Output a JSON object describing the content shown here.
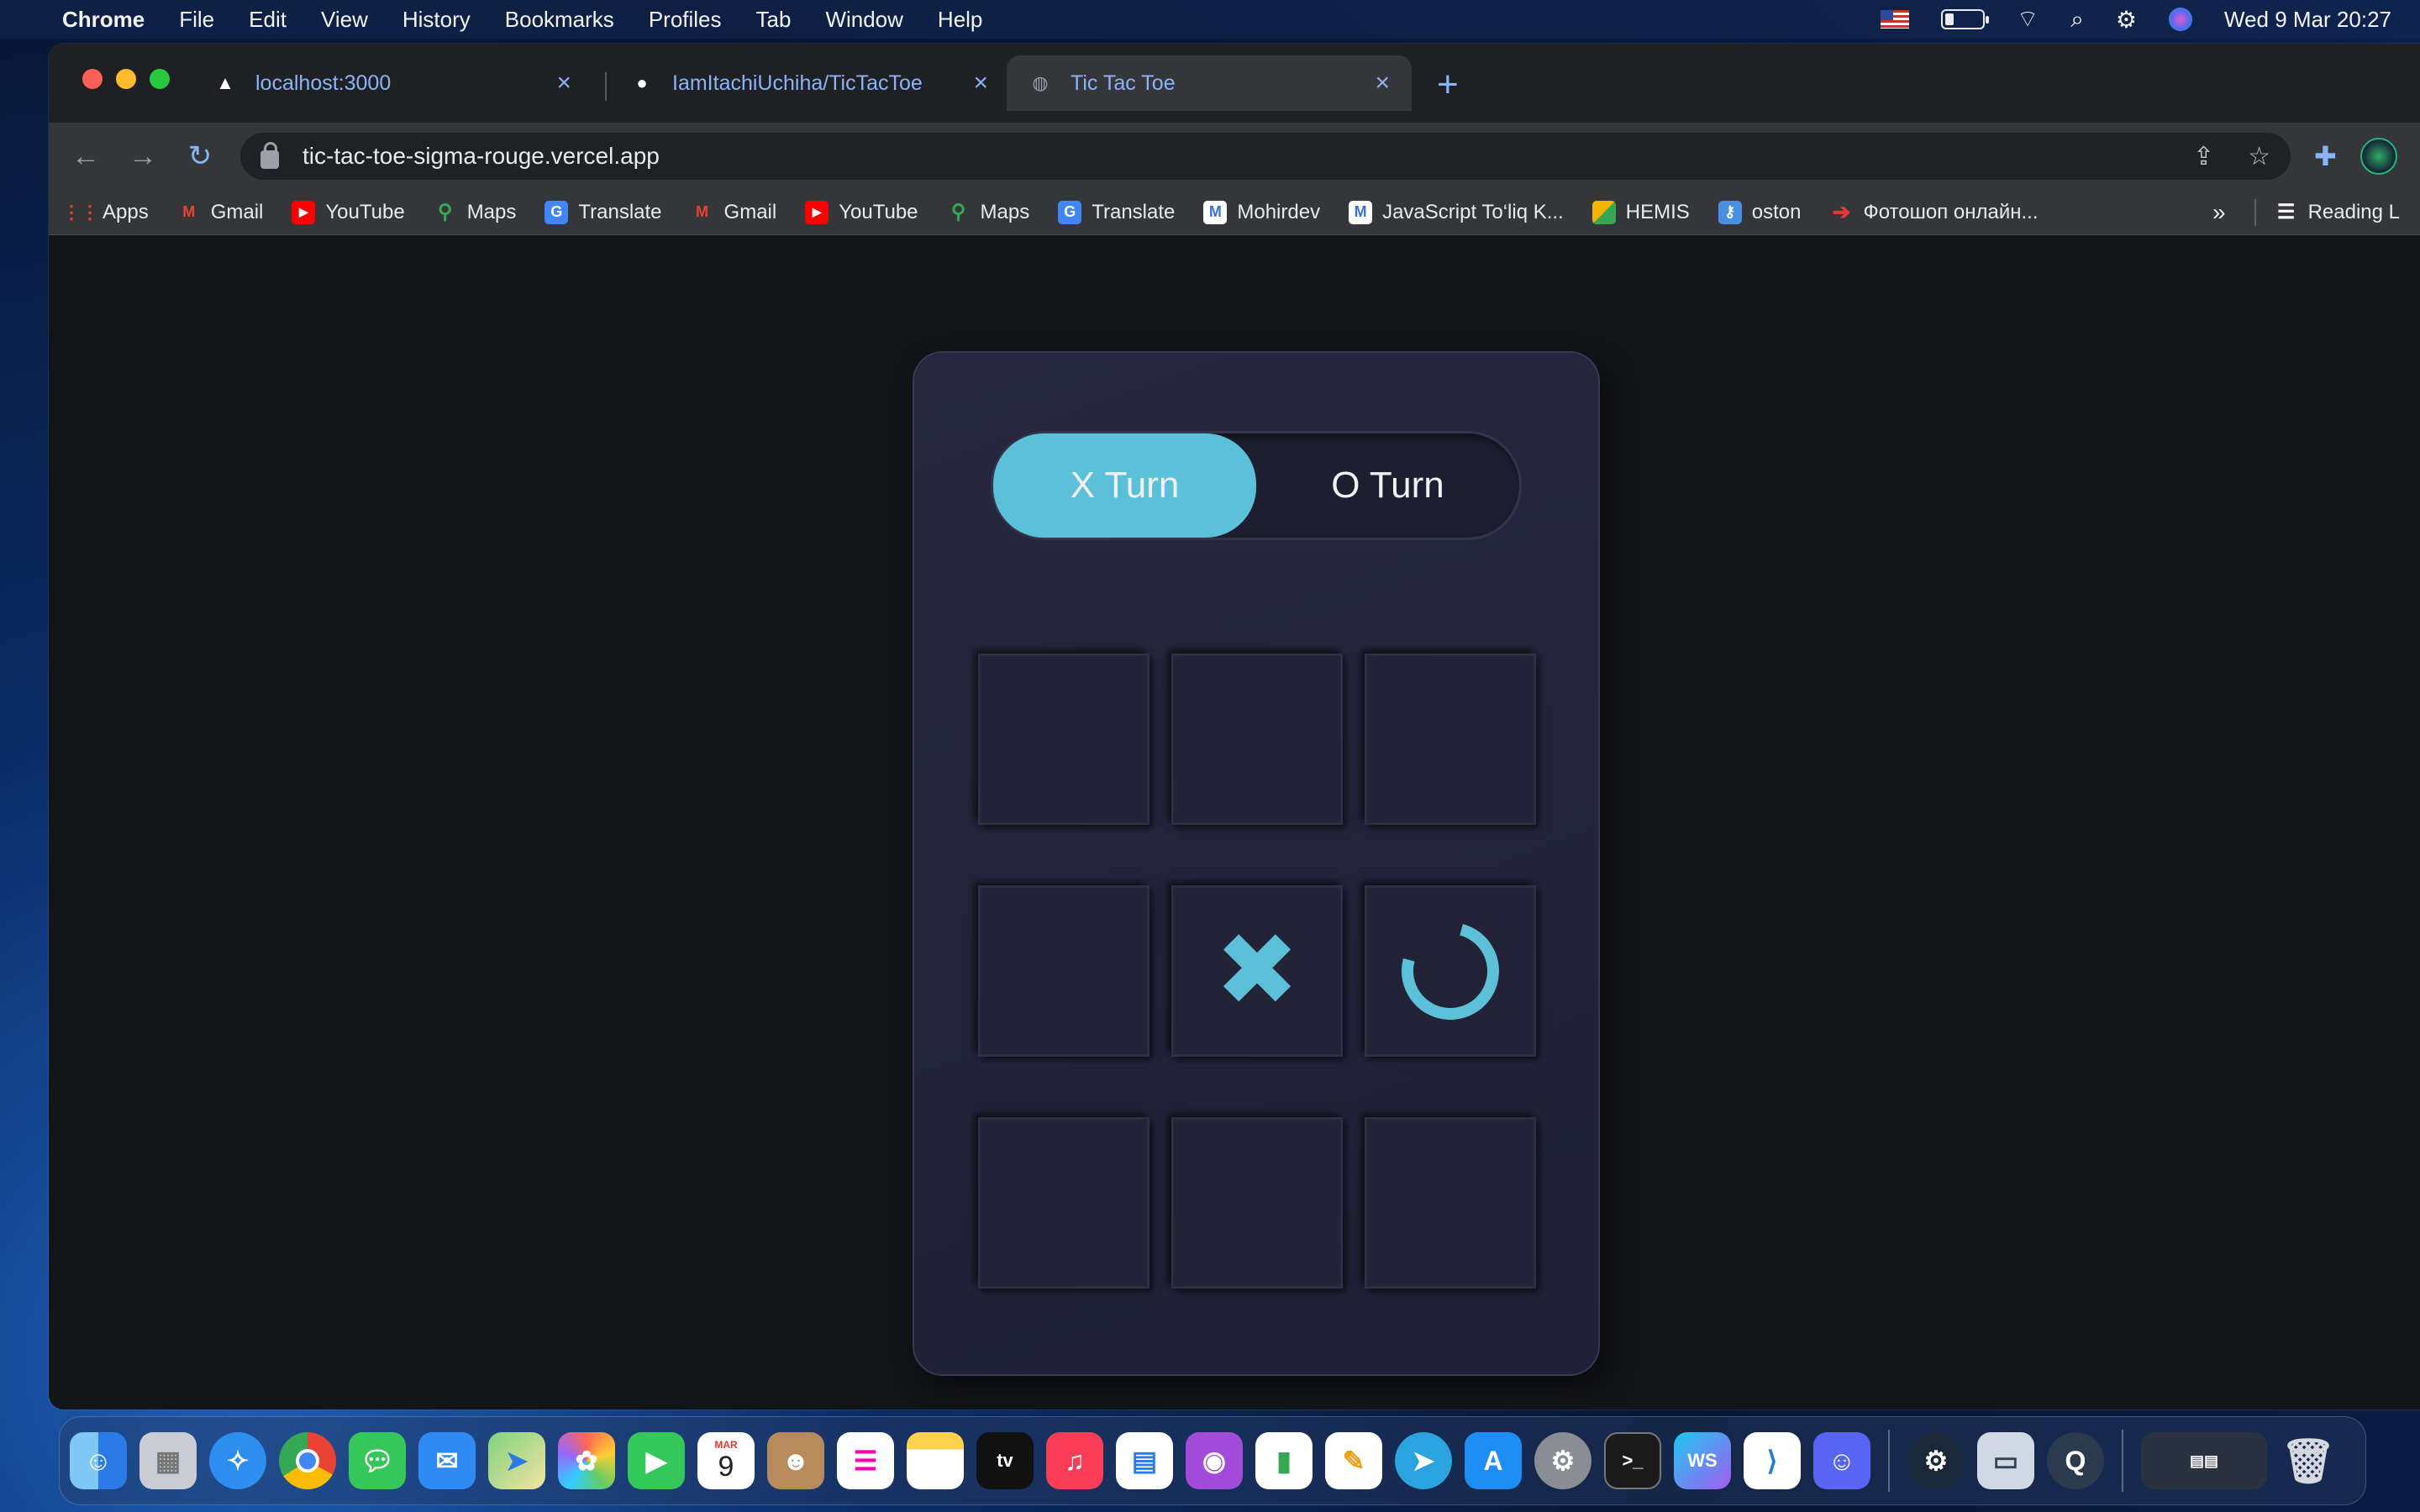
{
  "menubar": {
    "app_name": "Chrome",
    "items": [
      "File",
      "Edit",
      "View",
      "History",
      "Bookmarks",
      "Profiles",
      "Tab",
      "Window",
      "Help"
    ],
    "datetime": "Wed 9 Mar  20:27"
  },
  "tabs": [
    {
      "title": "localhost:3000",
      "icon": "triangle-icon"
    },
    {
      "title": "IamItachiUchiha/TicTacToe",
      "icon": "github-icon"
    },
    {
      "title": "Tic Tac Toe",
      "icon": "globe-icon",
      "active": true
    }
  ],
  "address_bar": {
    "url": "tic-tac-toe-sigma-rouge.vercel.app"
  },
  "bookmarks": [
    {
      "label": "Apps",
      "color": "#4285f4"
    },
    {
      "label": "Gmail",
      "color": "#ea4335"
    },
    {
      "label": "YouTube",
      "color": "#ff0000"
    },
    {
      "label": "Maps",
      "color": "#34a853"
    },
    {
      "label": "Translate",
      "color": "#4285f4"
    },
    {
      "label": "Gmail",
      "color": "#ea4335"
    },
    {
      "label": "YouTube",
      "color": "#ff0000"
    },
    {
      "label": "Maps",
      "color": "#34a853"
    },
    {
      "label": "Translate",
      "color": "#4285f4"
    },
    {
      "label": "Mohirdev",
      "color": "#3b6fd9"
    },
    {
      "label": "JavaScript To‘liq K...",
      "color": "#3b6fd9"
    },
    {
      "label": "HEMIS",
      "color": "#f4b400"
    },
    {
      "label": "oston",
      "color": "#4a90e2"
    },
    {
      "label": "Фотошоп онлайн...",
      "color": "#e53935"
    }
  ],
  "bookmarks_more": "»",
  "reading_list": "Reading L",
  "game": {
    "turn_x_label": "X Turn",
    "turn_o_label": "O Turn",
    "active_turn": "X",
    "accent_color": "#5cc1d8",
    "board": [
      "",
      "",
      "",
      "",
      "X",
      "O",
      "",
      "",
      ""
    ]
  },
  "dock": {
    "calendar_month": "MAR",
    "calendar_day": "9",
    "apps": [
      "Finder",
      "Launchpad",
      "Safari",
      "Chrome",
      "Messages",
      "Mail",
      "Maps",
      "Photos",
      "FaceTime",
      "Calendar",
      "Contacts",
      "Reminders",
      "Notes",
      "TV",
      "Music",
      "Keynote",
      "Podcasts",
      "Numbers",
      "Pages",
      "Telegram",
      "App Store",
      "System Preferences",
      "Terminal",
      "WebStorm",
      "VS Code",
      "Discord",
      "Steam",
      "Preview",
      "QuickTime",
      "Downloads",
      "Trash"
    ]
  }
}
